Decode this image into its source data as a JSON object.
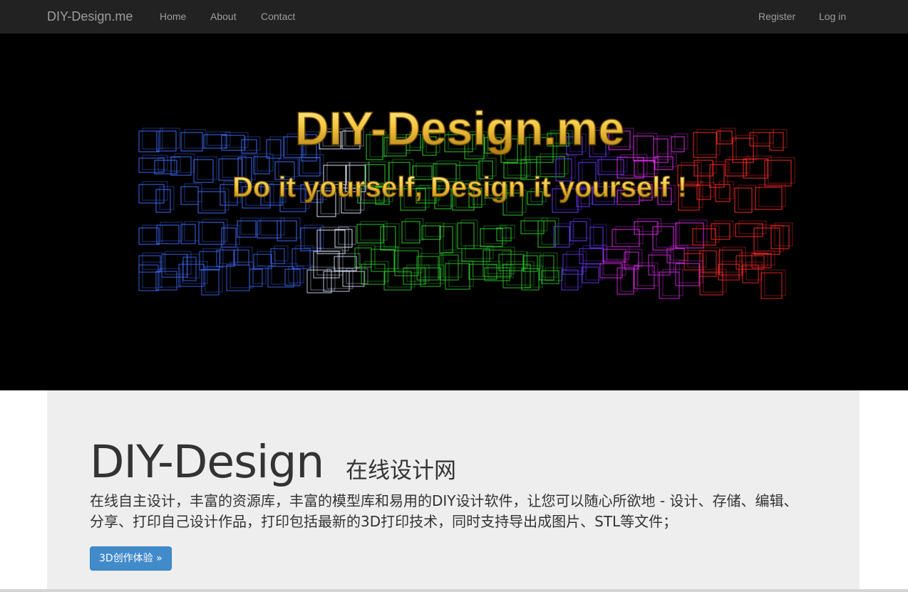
{
  "navbar": {
    "brand": "DIY-Design.me",
    "links": [
      "Home",
      "About",
      "Contact"
    ],
    "auth": [
      "Register",
      "Log in"
    ]
  },
  "banner": {
    "title": "DIY-Design.me",
    "tagline": "Do it yourself, Design it yourself !"
  },
  "jumbotron": {
    "title": "DIY-Design",
    "subtitle": "在线设计网",
    "description": "在线自主设计，丰富的资源库，丰富的模型库和易用的DIY设计软件，让您可以随心所欲地 - 设计、存储、编辑、分享、打印自己设计作品，打印包括最新的3D打印技术，同时支持导出成图片、STL等文件；",
    "button_label": "3D创作体验 »"
  },
  "colors": {
    "navbar_bg": "#222222",
    "nav_text": "#9d9d9d",
    "banner_bg": "#000000",
    "banner_text": "#f5c842",
    "jumbotron_bg": "#eeeeee",
    "button_primary": "#428bca"
  }
}
